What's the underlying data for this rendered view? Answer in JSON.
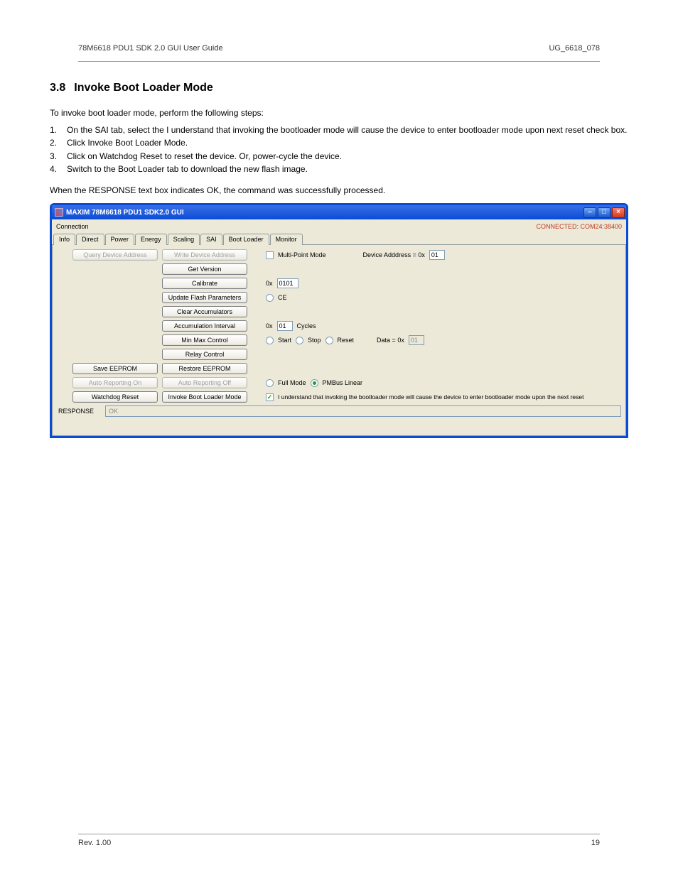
{
  "doc": {
    "header_left": "78M6618 PDU1 SDK 2.0 GUI User Guide",
    "header_right": "UG_6618_078",
    "footer_left": "Rev. 1.00",
    "footer_right": "19",
    "section_number": "3.8",
    "section_title": "Invoke Boot Loader Mode",
    "intro": "To invoke boot loader mode, perform the following steps:",
    "steps": [
      "On the SAI tab, select the I understand that invoking the bootloader mode will cause the device to enter bootloader mode upon next reset check box.",
      "Click Invoke Boot Loader Mode.",
      "Click on Watchdog Reset to reset the device. Or, power-cycle the device.",
      "Switch to the Boot Loader tab to download the new flash image."
    ],
    "outro": "When the RESPONSE text box indicates OK, the command was successfully processed."
  },
  "win": {
    "title": "MAXIM 78M6618 PDU1 SDK2.0 GUI",
    "menu": "Connection",
    "conn_status": "CONNECTED: COM24:38400",
    "tabs": [
      "Info",
      "Direct",
      "Power",
      "Energy",
      "Scaling",
      "SAI",
      "Boot Loader",
      "Monitor"
    ],
    "buttons": {
      "query_addr": "Query Device Address",
      "write_addr": "Write Device Address",
      "get_version": "Get Version",
      "calibrate": "Calibrate",
      "update_flash": "Update Flash Parameters",
      "clear_accum": "Clear Accumulators",
      "accum_interval": "Accumulation Interval",
      "minmax": "Min Max Control",
      "relay": "Relay Control",
      "save_eeprom": "Save EEPROM",
      "restore_eeprom": "Restore EEPROM",
      "auto_on": "Auto Reporting On",
      "auto_off": "Auto Reporting Off",
      "watchdog": "Watchdog Reset",
      "bootloader": "Invoke Boot Loader Mode"
    },
    "labels": {
      "multipoint": "Multi-Point Mode",
      "dev_addr_prefix": "Device Adddress = 0x",
      "dev_addr_val": "01",
      "hex_prefix": "0x",
      "calib_val": "0101",
      "ce": "CE",
      "accum_val": "01",
      "cycles": "Cycles",
      "start": "Start",
      "stop": "Stop",
      "reset": "Reset",
      "data_prefix": "Data = 0x",
      "data_val": "01",
      "fullmode": "Full Mode",
      "pmbus": "PMBus Linear",
      "boot_ack": "I understand that invoking the bootloader mode will cause the device to enter bootloader mode upon the next reset",
      "response_lbl": "RESPONSE",
      "response_val": "OK"
    }
  }
}
